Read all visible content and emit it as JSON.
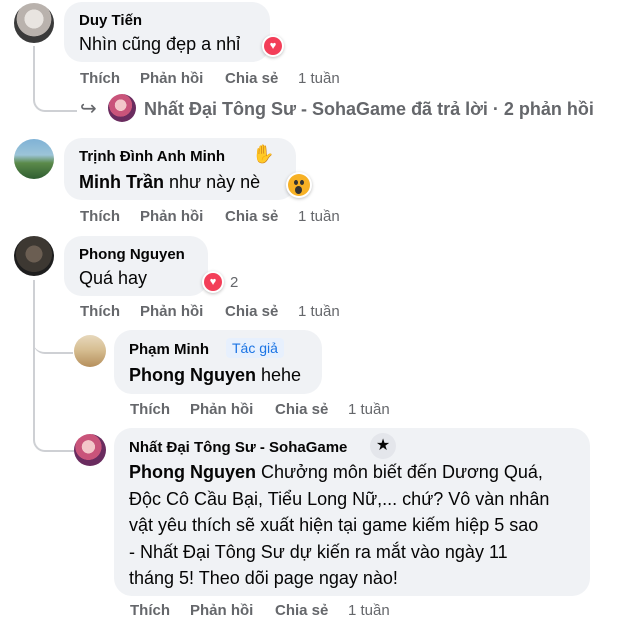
{
  "comments": [
    {
      "name": "Duy Tiến",
      "text": "Nhìn cũng đẹp a nhỉ",
      "actions": {
        "like": "Thích",
        "reply": "Phản hồi",
        "share": "Chia sẻ",
        "time": "1 tuần"
      },
      "reaction": "heart"
    },
    {
      "name": "Trịnh Đình Anh Minh",
      "mention": "Minh Trần",
      "text": " như này nè",
      "actions": {
        "like": "Thích",
        "reply": "Phản hồi",
        "share": "Chia sẻ",
        "time": "1 tuần"
      },
      "reaction": "wow",
      "name_icon": "waving-hand-icon"
    },
    {
      "name": "Phong Nguyen",
      "text": "Quá hay",
      "actions": {
        "like": "Thích",
        "reply": "Phản hồi",
        "share": "Chia sẻ",
        "time": "1 tuần"
      },
      "reaction": "heart",
      "reaction_count": "2"
    }
  ],
  "reply_summary": {
    "text": "Nhất Đại Tông Sư - SohaGame đã trả lời · 2 phản hồi",
    "icon": "reply-arrow-icon"
  },
  "replies": [
    {
      "name": "Phạm Minh",
      "badge": "Tác giả",
      "mention": "Phong Nguyen",
      "text": " hehe",
      "actions": {
        "like": "Thích",
        "reply": "Phản hồi",
        "share": "Chia sẻ",
        "time": "1 tuần"
      }
    },
    {
      "name": "Nhất Đại Tông Sư - SohaGame",
      "badge_icon": "star-icon",
      "mention": "Phong Nguyen",
      "lines": [
        " Chưởng môn biết đến Dương Quá,",
        "Độc Cô Cầu Bại, Tiểu Long Nữ,... chứ? Vô vàn nhân",
        "vật yêu thích sẽ xuất hiện tại game kiếm hiệp 5 sao",
        "- Nhất Đại Tông Sư dự kiến ra mắt vào ngày 11",
        "tháng 5! Theo dõi page ngay nào!"
      ],
      "actions": {
        "like": "Thích",
        "reply": "Phản hồi",
        "share": "Chia sẻ",
        "time": "1 tuần"
      }
    }
  ]
}
